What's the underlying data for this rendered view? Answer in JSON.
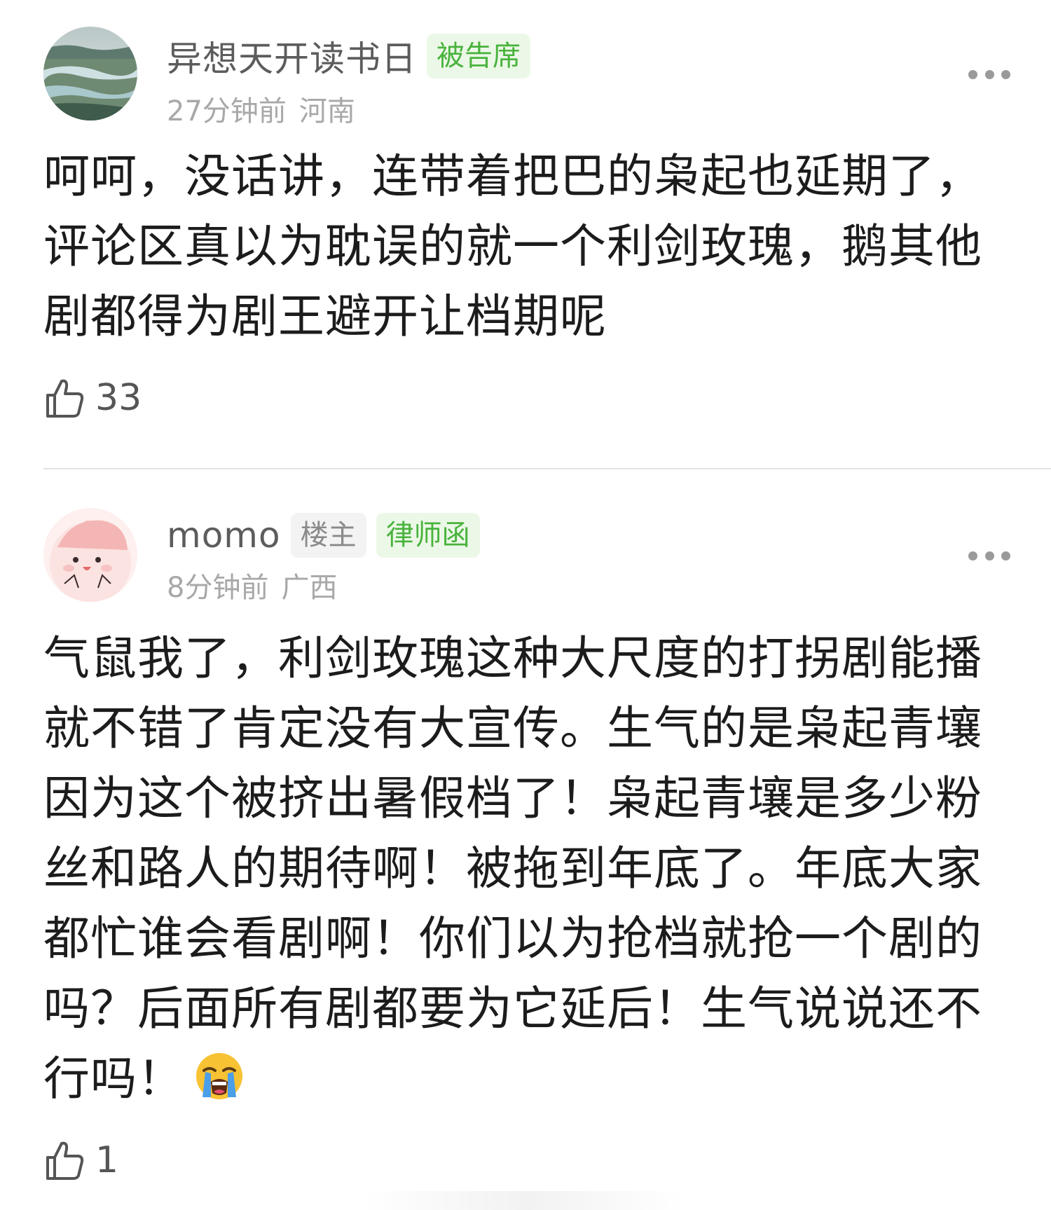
{
  "comments": [
    {
      "username": "异想天开读书日",
      "badges": [
        "被告席"
      ],
      "time": "27分钟前",
      "location": "河南",
      "lines": [
        "呵呵，没话讲，连带着把巴的枭起也延期了，",
        "评论区真以为耽误的就一个利剑玫瑰，鹅其他",
        "剧都得为剧王避开让档期呢"
      ],
      "likes": "33",
      "avatar_icon": "landscape-river-avatar"
    },
    {
      "username": "momo",
      "op_badge": "楼主",
      "badges": [
        "律师函"
      ],
      "time": "8分钟前",
      "location": "广西",
      "lines": [
        "气鼠我了，利剑玫瑰这种大尺度的打拐剧能播",
        "就不错了肯定没有大宣传。生气的是枭起青壤",
        "因为这个被挤出暑假档了！枭起青壤是多少粉",
        "丝和路人的期待啊！被拖到年底了。年底大家",
        "都忙谁会看剧啊！你们以为抢档就抢一个剧的",
        "吗？后面所有剧都要为它延后！生气说说还不",
        "行吗！"
      ],
      "emoji": "loudly-crying-face-icon",
      "likes": "1",
      "avatar_icon": "pink-cartoon-avatar"
    }
  ],
  "colors": {
    "username": "#5c5c5c",
    "meta": "#a8a8a8",
    "badge_green_text": "#49b33d",
    "badge_green_bg": "#ecf8e7",
    "badge_gray_text": "#8a8a8a",
    "badge_gray_bg": "#f3f3f3",
    "body_text": "#1c1c1c"
  }
}
